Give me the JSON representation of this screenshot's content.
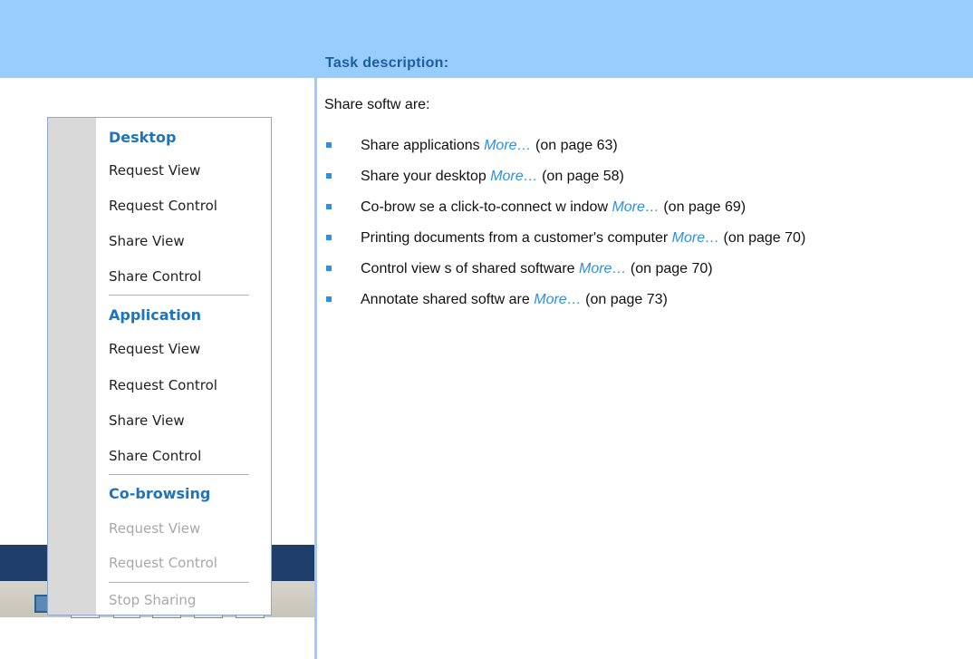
{
  "header": {
    "task_title": "Task description:"
  },
  "menu": {
    "sections": [
      {
        "heading": "Desktop",
        "items": [
          "Request View",
          "Request Control",
          "Share View",
          "Share Control"
        ]
      },
      {
        "heading": "Application",
        "items": [
          "Request View",
          "Request Control",
          "Share View",
          "Share Control"
        ]
      },
      {
        "heading": "Co-browsing",
        "items": [
          "Request View",
          "Request Control"
        ]
      }
    ],
    "stop_sharing": "Stop Sharing"
  },
  "content": {
    "intro": "Share softw are:",
    "bullets": [
      {
        "text": "Share applications ",
        "more": "More…",
        "page": " (on page 63)"
      },
      {
        "text": "Share your desktop ",
        "more": "More…",
        "page": " (on page 58)"
      },
      {
        "text": "Co-brow se a click-to-connect w indow  ",
        "more": "More…",
        "page": " (on page 69)"
      },
      {
        "text": "Printing documents from a customer's computer ",
        "more": "More…",
        "page": " (on page 70)"
      },
      {
        "text": "Control view s of shared software ",
        "more": "More…",
        "page": " (on page 70)"
      },
      {
        "text": "Annotate shared softw are ",
        "more": "More…",
        "page": " (on page 73)"
      }
    ]
  },
  "colors": {
    "banner": "#99ccff",
    "accent": "#2f8fe0",
    "menu_heading": "#1e73be"
  }
}
